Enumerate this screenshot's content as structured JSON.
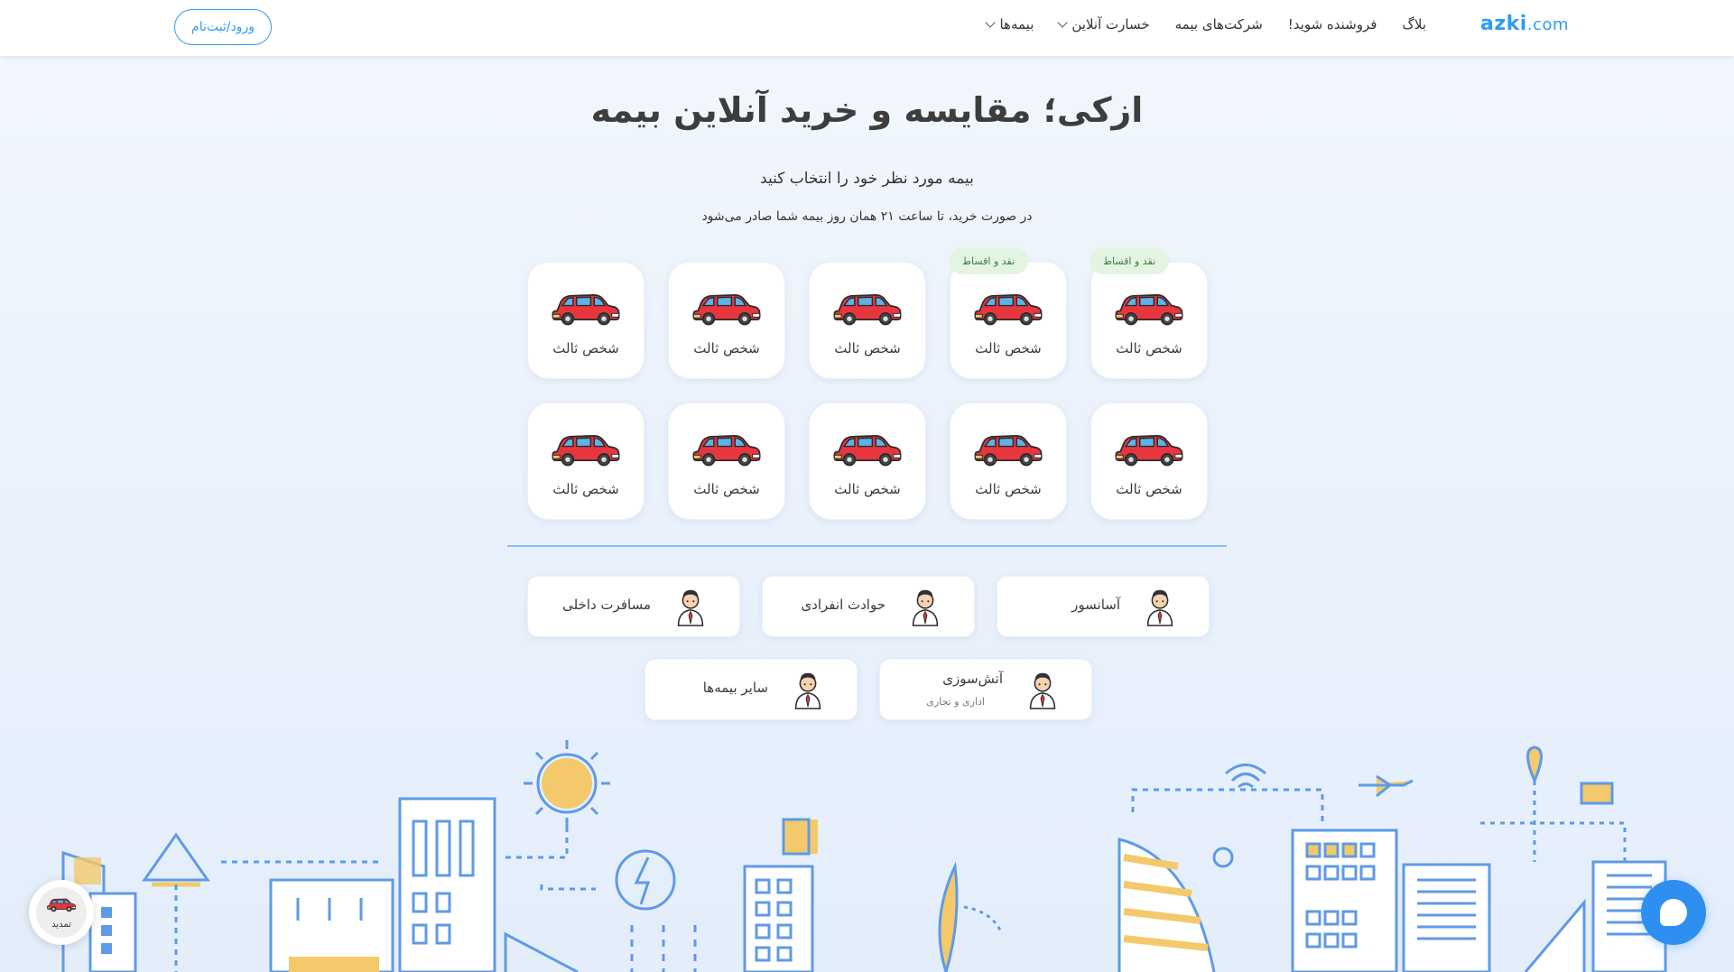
{
  "header": {
    "logo": {
      "brand": "azki",
      "domain": ".com"
    },
    "nav": [
      {
        "label": "بیمه‌ها",
        "has_dropdown": true
      },
      {
        "label": "خسارت آنلاین",
        "has_dropdown": true
      },
      {
        "label": "شرکت‌های بیمه",
        "has_dropdown": false
      },
      {
        "label": "فروشنده شوید!",
        "has_dropdown": false
      },
      {
        "label": "بلاگ",
        "has_dropdown": false
      }
    ],
    "login_label": "ورود/ثبت‌نام"
  },
  "hero": {
    "title": "ازکی؛ مقایسه و خرید آنلاین بیمه",
    "subtitle": "بیمه مورد نظر خود را انتخاب کنید",
    "note": "در صورت خرید، تا ساعت ۲۱ همان روز بیمه شما صادر می‌شود"
  },
  "car_cards": [
    {
      "label": "شخص ثالث",
      "badge": "نقد و اقساط"
    },
    {
      "label": "شخص ثالث",
      "badge": "نقد و اقساط"
    },
    {
      "label": "شخص ثالث",
      "badge": ""
    },
    {
      "label": "شخص ثالث",
      "badge": ""
    },
    {
      "label": "شخص ثالث",
      "badge": ""
    },
    {
      "label": "شخص ثالث",
      "badge": ""
    },
    {
      "label": "شخص ثالث",
      "badge": ""
    },
    {
      "label": "شخص ثالث",
      "badge": ""
    },
    {
      "label": "شخص ثالث",
      "badge": ""
    },
    {
      "label": "شخص ثالث",
      "badge": ""
    }
  ],
  "other_insurances": [
    {
      "label": "آسانسور",
      "sub": ""
    },
    {
      "label": "حوادث انفرادی",
      "sub": ""
    },
    {
      "label": "مسافرت داخلی",
      "sub": ""
    },
    {
      "label": "آتش‌سوزی",
      "sub": "اداری و تجاری"
    },
    {
      "label": "سایر بیمه‌ها",
      "sub": ""
    }
  ],
  "renew_label": "تمدید",
  "colors": {
    "accent": "#2f9bf0",
    "car_red": "#e8363f",
    "badge_bg": "#e3f4e1",
    "badge_text": "#3c7f3a",
    "city_blue": "#5f9ae6",
    "city_yellow": "#f3c96b"
  }
}
